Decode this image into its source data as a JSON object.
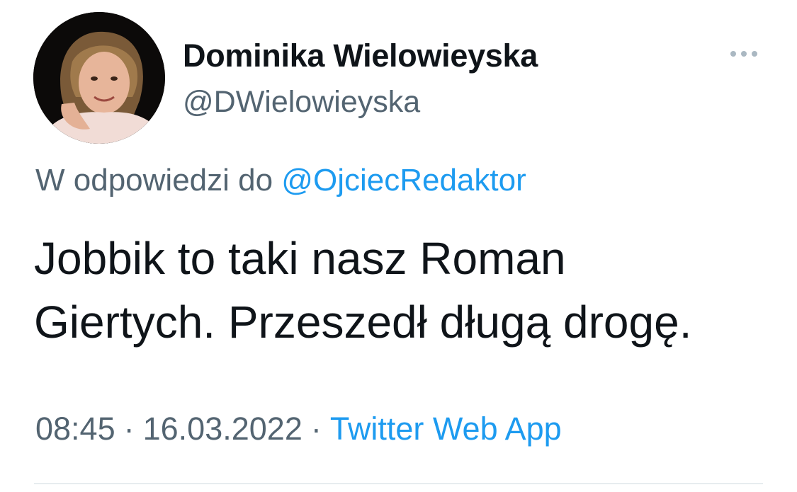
{
  "author": {
    "display_name": "Dominika Wielowieyska",
    "handle": "@DWielowieyska"
  },
  "more_icon": "more-horizontal-icon",
  "reply": {
    "prefix": "W odpowiedzi do ",
    "mention": "@OjciecRedaktor"
  },
  "tweet": {
    "text": "Jobbik to taki nasz Roman\nGiertych. Przeszedł długą drogę."
  },
  "meta": {
    "time": "08:45",
    "separator": "·",
    "date": "16.03.2022",
    "source": "Twitter Web App"
  },
  "colors": {
    "text": "#0f1419",
    "secondary": "#536471",
    "link": "#1d9bf0",
    "divider": "#cfd9de"
  }
}
